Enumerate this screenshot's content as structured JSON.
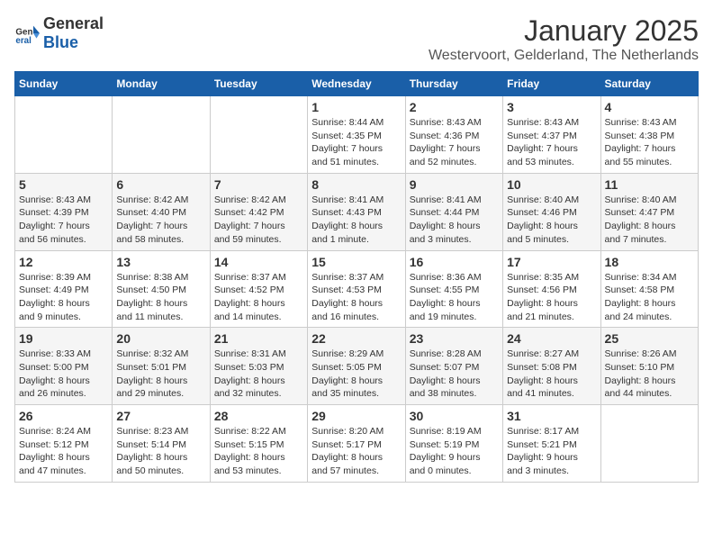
{
  "logo": {
    "general": "General",
    "blue": "Blue"
  },
  "title": "January 2025",
  "subtitle": "Westervoort, Gelderland, The Netherlands",
  "days_of_week": [
    "Sunday",
    "Monday",
    "Tuesday",
    "Wednesday",
    "Thursday",
    "Friday",
    "Saturday"
  ],
  "weeks": [
    [
      {
        "day": "",
        "info": ""
      },
      {
        "day": "",
        "info": ""
      },
      {
        "day": "",
        "info": ""
      },
      {
        "day": "1",
        "info": "Sunrise: 8:44 AM\nSunset: 4:35 PM\nDaylight: 7 hours\nand 51 minutes."
      },
      {
        "day": "2",
        "info": "Sunrise: 8:43 AM\nSunset: 4:36 PM\nDaylight: 7 hours\nand 52 minutes."
      },
      {
        "day": "3",
        "info": "Sunrise: 8:43 AM\nSunset: 4:37 PM\nDaylight: 7 hours\nand 53 minutes."
      },
      {
        "day": "4",
        "info": "Sunrise: 8:43 AM\nSunset: 4:38 PM\nDaylight: 7 hours\nand 55 minutes."
      }
    ],
    [
      {
        "day": "5",
        "info": "Sunrise: 8:43 AM\nSunset: 4:39 PM\nDaylight: 7 hours\nand 56 minutes."
      },
      {
        "day": "6",
        "info": "Sunrise: 8:42 AM\nSunset: 4:40 PM\nDaylight: 7 hours\nand 58 minutes."
      },
      {
        "day": "7",
        "info": "Sunrise: 8:42 AM\nSunset: 4:42 PM\nDaylight: 7 hours\nand 59 minutes."
      },
      {
        "day": "8",
        "info": "Sunrise: 8:41 AM\nSunset: 4:43 PM\nDaylight: 8 hours\nand 1 minute."
      },
      {
        "day": "9",
        "info": "Sunrise: 8:41 AM\nSunset: 4:44 PM\nDaylight: 8 hours\nand 3 minutes."
      },
      {
        "day": "10",
        "info": "Sunrise: 8:40 AM\nSunset: 4:46 PM\nDaylight: 8 hours\nand 5 minutes."
      },
      {
        "day": "11",
        "info": "Sunrise: 8:40 AM\nSunset: 4:47 PM\nDaylight: 8 hours\nand 7 minutes."
      }
    ],
    [
      {
        "day": "12",
        "info": "Sunrise: 8:39 AM\nSunset: 4:49 PM\nDaylight: 8 hours\nand 9 minutes."
      },
      {
        "day": "13",
        "info": "Sunrise: 8:38 AM\nSunset: 4:50 PM\nDaylight: 8 hours\nand 11 minutes."
      },
      {
        "day": "14",
        "info": "Sunrise: 8:37 AM\nSunset: 4:52 PM\nDaylight: 8 hours\nand 14 minutes."
      },
      {
        "day": "15",
        "info": "Sunrise: 8:37 AM\nSunset: 4:53 PM\nDaylight: 8 hours\nand 16 minutes."
      },
      {
        "day": "16",
        "info": "Sunrise: 8:36 AM\nSunset: 4:55 PM\nDaylight: 8 hours\nand 19 minutes."
      },
      {
        "day": "17",
        "info": "Sunrise: 8:35 AM\nSunset: 4:56 PM\nDaylight: 8 hours\nand 21 minutes."
      },
      {
        "day": "18",
        "info": "Sunrise: 8:34 AM\nSunset: 4:58 PM\nDaylight: 8 hours\nand 24 minutes."
      }
    ],
    [
      {
        "day": "19",
        "info": "Sunrise: 8:33 AM\nSunset: 5:00 PM\nDaylight: 8 hours\nand 26 minutes."
      },
      {
        "day": "20",
        "info": "Sunrise: 8:32 AM\nSunset: 5:01 PM\nDaylight: 8 hours\nand 29 minutes."
      },
      {
        "day": "21",
        "info": "Sunrise: 8:31 AM\nSunset: 5:03 PM\nDaylight: 8 hours\nand 32 minutes."
      },
      {
        "day": "22",
        "info": "Sunrise: 8:29 AM\nSunset: 5:05 PM\nDaylight: 8 hours\nand 35 minutes."
      },
      {
        "day": "23",
        "info": "Sunrise: 8:28 AM\nSunset: 5:07 PM\nDaylight: 8 hours\nand 38 minutes."
      },
      {
        "day": "24",
        "info": "Sunrise: 8:27 AM\nSunset: 5:08 PM\nDaylight: 8 hours\nand 41 minutes."
      },
      {
        "day": "25",
        "info": "Sunrise: 8:26 AM\nSunset: 5:10 PM\nDaylight: 8 hours\nand 44 minutes."
      }
    ],
    [
      {
        "day": "26",
        "info": "Sunrise: 8:24 AM\nSunset: 5:12 PM\nDaylight: 8 hours\nand 47 minutes."
      },
      {
        "day": "27",
        "info": "Sunrise: 8:23 AM\nSunset: 5:14 PM\nDaylight: 8 hours\nand 50 minutes."
      },
      {
        "day": "28",
        "info": "Sunrise: 8:22 AM\nSunset: 5:15 PM\nDaylight: 8 hours\nand 53 minutes."
      },
      {
        "day": "29",
        "info": "Sunrise: 8:20 AM\nSunset: 5:17 PM\nDaylight: 8 hours\nand 57 minutes."
      },
      {
        "day": "30",
        "info": "Sunrise: 8:19 AM\nSunset: 5:19 PM\nDaylight: 9 hours\nand 0 minutes."
      },
      {
        "day": "31",
        "info": "Sunrise: 8:17 AM\nSunset: 5:21 PM\nDaylight: 9 hours\nand 3 minutes."
      },
      {
        "day": "",
        "info": ""
      }
    ]
  ]
}
